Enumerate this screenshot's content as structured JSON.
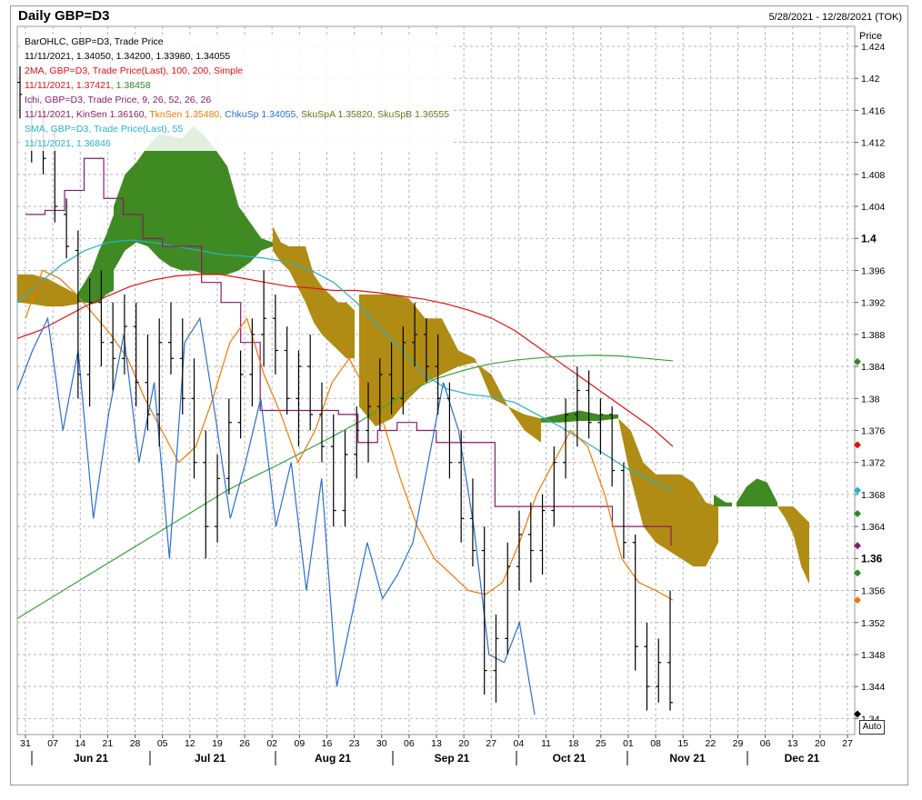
{
  "header": {
    "title": "Daily GBP=D3",
    "date_range": "5/28/2021 - 12/28/2021 (TOK)"
  },
  "legend": [
    {
      "text": "BarOHLC, GBP=D3, Trade Price",
      "color": "#000000"
    },
    {
      "text": "11/11/2021, 1.34050, 1.34200, 1.33980, 1.34055",
      "color": "#000000"
    },
    {
      "text": "2MA, GBP=D3, Trade Price(Last),  100, 200, Simple",
      "color": "#e01010"
    },
    {
      "parts": [
        {
          "text": "11/11/2021, 1.37421",
          "color": "#e01010"
        },
        {
          "text": ",  1.38458",
          "color": "#2a8a2a"
        }
      ]
    },
    {
      "text": "Ichi, GBP=D3, Trade Price,  9, 26, 52, 26, 26",
      "color": "#8b1a6b"
    },
    {
      "parts": [
        {
          "text": "11/11/2021, KinSen 1.36160, ",
          "color": "#8b1a6b"
        },
        {
          "text": "TknSen 1.35480, ",
          "color": "#f07800"
        },
        {
          "text": "ChkuSp 1.34055, ",
          "color": "#2a6fd0"
        },
        {
          "text": "SkuSpA 1.35820, SkuSpB 1.36555",
          "color": "#5a7a1a"
        }
      ]
    },
    {
      "text": "SMA, GBP=D3, Trade Price(Last),  55",
      "color": "#26b3c8"
    },
    {
      "text": "11/11/2021, 1.36846",
      "color": "#26b3c8"
    }
  ],
  "axis": {
    "price_label": "Price",
    "auto_label": "Auto"
  },
  "chart_data": {
    "type": "line",
    "title": "Daily GBP=D3",
    "ylabel": "Price",
    "ylim": [
      1.338,
      1.4265
    ],
    "y_ticks": [
      1.424,
      1.42,
      1.416,
      1.412,
      1.408,
      1.404,
      1.4,
      1.396,
      1.392,
      1.388,
      1.384,
      1.38,
      1.376,
      1.372,
      1.368,
      1.364,
      1.36,
      1.356,
      1.352,
      1.348,
      1.344,
      1.34
    ],
    "y_tick_labels": [
      "1.424",
      "1.42",
      "1.416",
      "1.412",
      "1.408",
      "1.404",
      "1.4",
      "1.396",
      "1.392",
      "1.388",
      "1.384",
      "1.38",
      "1.376",
      "1.372",
      "1.368",
      "1.364",
      "1.36",
      "1.356",
      "1.352",
      "1.348",
      "1.344",
      "1.34"
    ],
    "y_tick_bold": [
      "1.4",
      "1.36"
    ],
    "x_day_labels": [
      "31",
      "07",
      "14",
      "21",
      "28",
      "05",
      "12",
      "19",
      "26",
      "02",
      "09",
      "16",
      "23",
      "30",
      "06",
      "13",
      "20",
      "27",
      "04",
      "11",
      "18",
      "25",
      "01",
      "08",
      "15",
      "22",
      "29",
      "06",
      "13",
      "20",
      "27"
    ],
    "x_month_labels": [
      "Jun 21",
      "Jul 21",
      "Aug 21",
      "Sep 21",
      "Oct 21",
      "Nov 21",
      "Dec 21"
    ],
    "grid": true,
    "right_axis_markers": [
      {
        "value": 1.3846,
        "color": "#2a8a2a"
      },
      {
        "value": 1.3742,
        "color": "#e01010"
      },
      {
        "value": 1.3685,
        "color": "#26b3c8"
      },
      {
        "value": 1.3656,
        "color": "#2a8a2a"
      },
      {
        "value": 1.3616,
        "color": "#8b1a6b"
      },
      {
        "value": 1.3582,
        "color": "#2a8a2a"
      },
      {
        "value": 1.3548,
        "color": "#f07800"
      },
      {
        "value": 1.34055,
        "color": "#000000"
      }
    ],
    "ohlc": [
      [
        1.4195,
        1.4215,
        1.415,
        1.418
      ],
      [
        1.415,
        1.418,
        1.4095,
        1.412
      ],
      [
        1.414,
        1.4165,
        1.408,
        1.41
      ],
      [
        1.413,
        1.414,
        1.402,
        1.404
      ],
      [
        1.403,
        1.405,
        1.3975,
        1.399
      ],
      [
        1.3985,
        1.401,
        1.38,
        1.383
      ],
      [
        1.383,
        1.395,
        1.379,
        1.392
      ],
      [
        1.392,
        1.396,
        1.384,
        1.387
      ],
      [
        1.387,
        1.392,
        1.381,
        1.385
      ],
      [
        1.385,
        1.393,
        1.383,
        1.389
      ],
      [
        1.389,
        1.392,
        1.379,
        1.382
      ],
      [
        1.382,
        1.388,
        1.376,
        1.378
      ],
      [
        1.378,
        1.39,
        1.374,
        1.387
      ],
      [
        1.387,
        1.392,
        1.383,
        1.385
      ],
      [
        1.385,
        1.39,
        1.378,
        1.38
      ],
      [
        1.38,
        1.385,
        1.37,
        1.372
      ],
      [
        1.372,
        1.376,
        1.36,
        1.364
      ],
      [
        1.364,
        1.373,
        1.362,
        1.37
      ],
      [
        1.37,
        1.38,
        1.368,
        1.377
      ],
      [
        1.377,
        1.386,
        1.375,
        1.383
      ],
      [
        1.383,
        1.39,
        1.379,
        1.388
      ],
      [
        1.388,
        1.396,
        1.384,
        1.39
      ],
      [
        1.39,
        1.393,
        1.383,
        1.386
      ],
      [
        1.386,
        1.389,
        1.378,
        1.38
      ],
      [
        1.38,
        1.386,
        1.374,
        1.384
      ],
      [
        1.384,
        1.388,
        1.376,
        1.378
      ],
      [
        1.378,
        1.382,
        1.372,
        1.374
      ],
      [
        1.374,
        1.378,
        1.364,
        1.366
      ],
      [
        1.366,
        1.376,
        1.364,
        1.373
      ],
      [
        1.373,
        1.379,
        1.37,
        1.376
      ],
      [
        1.376,
        1.382,
        1.372,
        1.379
      ],
      [
        1.379,
        1.385,
        1.376,
        1.383
      ],
      [
        1.383,
        1.387,
        1.378,
        1.38
      ],
      [
        1.38,
        1.389,
        1.378,
        1.387
      ],
      [
        1.387,
        1.392,
        1.384,
        1.388
      ],
      [
        1.388,
        1.39,
        1.382,
        1.384
      ],
      [
        1.384,
        1.388,
        1.378,
        1.38
      ],
      [
        1.38,
        1.382,
        1.37,
        1.372
      ],
      [
        1.372,
        1.376,
        1.362,
        1.365
      ],
      [
        1.365,
        1.37,
        1.359,
        1.361
      ],
      [
        1.361,
        1.364,
        1.343,
        1.346
      ],
      [
        1.346,
        1.353,
        1.342,
        1.35
      ],
      [
        1.35,
        1.362,
        1.348,
        1.359
      ],
      [
        1.359,
        1.366,
        1.356,
        1.363
      ],
      [
        1.363,
        1.367,
        1.357,
        1.361
      ],
      [
        1.361,
        1.368,
        1.358,
        1.366
      ],
      [
        1.366,
        1.374,
        1.364,
        1.372
      ],
      [
        1.372,
        1.38,
        1.37,
        1.378
      ],
      [
        1.378,
        1.384,
        1.374,
        1.381
      ],
      [
        1.381,
        1.3835,
        1.375,
        1.377
      ],
      [
        1.377,
        1.38,
        1.373,
        1.378
      ],
      [
        1.378,
        1.379,
        1.369,
        1.371
      ],
      [
        1.371,
        1.372,
        1.36,
        1.362
      ],
      [
        1.362,
        1.363,
        1.346,
        1.349
      ],
      [
        1.349,
        1.352,
        1.341,
        1.344
      ],
      [
        1.344,
        1.35,
        1.342,
        1.347
      ],
      [
        1.347,
        1.356,
        1.341,
        1.342
      ]
    ],
    "series": [
      {
        "name": "MA 100",
        "color": "#e01010",
        "values": [
          1.3875,
          1.3885,
          1.39,
          1.3915,
          1.3928,
          1.394,
          1.3948,
          1.3953,
          1.3955,
          1.3955,
          1.395,
          1.3945,
          1.394,
          1.3938,
          1.3935,
          1.3935,
          1.3932,
          1.3928,
          1.3924,
          1.3918,
          1.391,
          1.39,
          1.3885,
          1.3865,
          1.3845,
          1.3825,
          1.3805,
          1.3785,
          1.3765,
          1.374
        ]
      },
      {
        "name": "MA 200",
        "color": "#38a238",
        "values": [
          1.3525,
          1.3545,
          1.3565,
          1.3585,
          1.3605,
          1.3625,
          1.3645,
          1.3665,
          1.3685,
          1.3702,
          1.3718,
          1.3735,
          1.3752,
          1.377,
          1.379,
          1.381,
          1.3825,
          1.3835,
          1.3843,
          1.3848,
          1.3851,
          1.3853,
          1.3854,
          1.3853,
          1.385,
          1.3847
        ]
      },
      {
        "name": "SMA 55",
        "color": "#26b3c8",
        "values": [
          1.392,
          1.3945,
          1.3968,
          1.3985,
          1.3995,
          1.3998,
          1.3995,
          1.399,
          1.3985,
          1.398,
          1.3978,
          1.3975,
          1.397,
          1.396,
          1.3945,
          1.392,
          1.389,
          1.386,
          1.383,
          1.3812,
          1.3805,
          1.3802,
          1.3795,
          1.378,
          1.3765,
          1.3748,
          1.373,
          1.3712,
          1.3698,
          1.3685
        ]
      },
      {
        "name": "KinSen",
        "color": "#8b1a6b",
        "values": [
          1.403,
          1.4035,
          1.406,
          1.41,
          1.405,
          1.403,
          1.4,
          1.399,
          1.399,
          1.3945,
          1.392,
          1.387,
          1.3785,
          1.3785,
          1.3785,
          1.3785,
          1.378,
          1.3745,
          1.376,
          1.377,
          1.376,
          1.3745,
          1.3745,
          1.3745,
          1.3665,
          1.3665,
          1.3665,
          1.3665,
          1.3665,
          1.3665,
          1.364,
          1.364,
          1.364,
          1.3616
        ]
      },
      {
        "name": "TknSen",
        "color": "#f07800",
        "values": [
          1.39,
          1.396,
          1.395,
          1.393,
          1.3905,
          1.388,
          1.385,
          1.38,
          1.376,
          1.372,
          1.374,
          1.38,
          1.387,
          1.39,
          1.383,
          1.378,
          1.372,
          1.376,
          1.382,
          1.385,
          1.381,
          1.377,
          1.37,
          1.364,
          1.36,
          1.358,
          1.356,
          1.3555,
          1.357,
          1.362,
          1.368,
          1.372,
          1.376,
          1.374,
          1.368,
          1.36,
          1.357,
          1.356,
          1.3548
        ]
      },
      {
        "name": "ChkuSp",
        "color": "#2a6fd0",
        "values": [
          1.381,
          1.386,
          1.39,
          1.376,
          1.386,
          1.365,
          1.378,
          1.388,
          1.372,
          1.382,
          1.36,
          1.387,
          1.39,
          1.378,
          1.365,
          1.372,
          1.38,
          1.364,
          1.372,
          1.356,
          1.37,
          1.344,
          1.353,
          1.362,
          1.355,
          1.358,
          1.362,
          1.372,
          1.382,
          1.376,
          1.364,
          1.348,
          1.347,
          1.352,
          1.3405
        ]
      }
    ],
    "cloud": {
      "green_label": "SkuSpA",
      "gold_label": "SkuSpB",
      "span_a": 1.3582,
      "span_b": 1.36555
    }
  }
}
